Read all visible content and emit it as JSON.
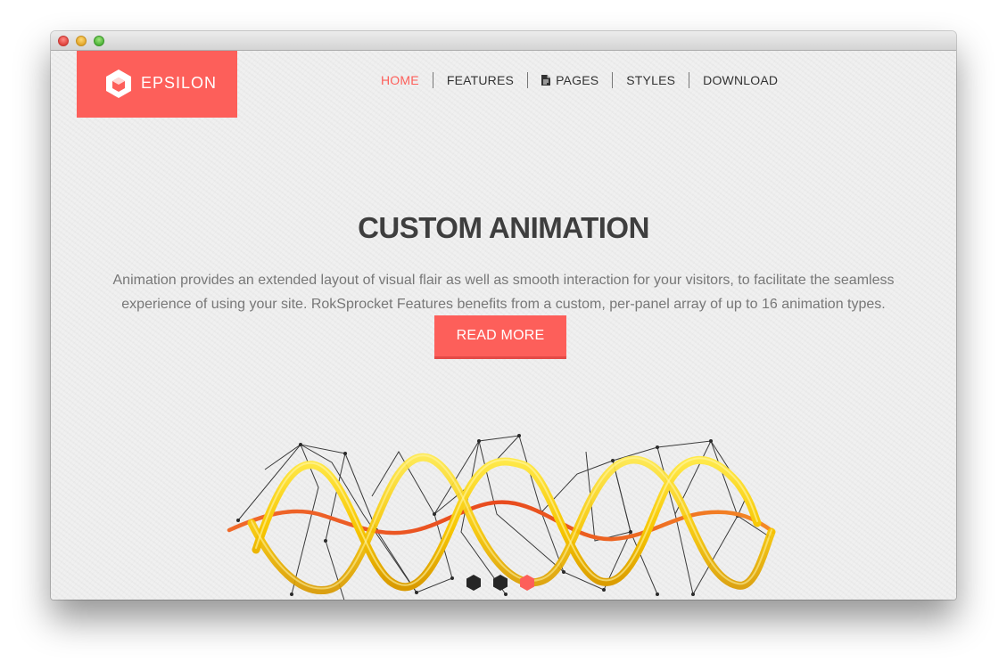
{
  "window": {
    "traffic_lights": [
      "close",
      "minimize",
      "zoom"
    ]
  },
  "brand": {
    "name": "EPSILON",
    "icon": "hexagon-cube-icon",
    "color": "#fd5f5a"
  },
  "nav": {
    "items": [
      {
        "label": "HOME",
        "active": true
      },
      {
        "label": "FEATURES",
        "active": false
      },
      {
        "label": "PAGES",
        "active": false,
        "icon": "document-icon"
      },
      {
        "label": "STYLES",
        "active": false
      },
      {
        "label": "DOWNLOAD",
        "active": false
      }
    ]
  },
  "hero": {
    "title": "CUSTOM ANIMATION",
    "description": "Animation provides an extended layout of visual flair as well as smooth interaction for your visitors, to facilitate the seamless experience of using your site. RokSprocket Features benefits from a custom, per-panel array of up to 16 animation types.",
    "cta_label": "READ MORE",
    "image": "dna-helix-illustration"
  },
  "slider": {
    "count": 3,
    "active_index": 2,
    "colors": {
      "inactive": "#262626",
      "active": "#fd5f5a"
    }
  }
}
